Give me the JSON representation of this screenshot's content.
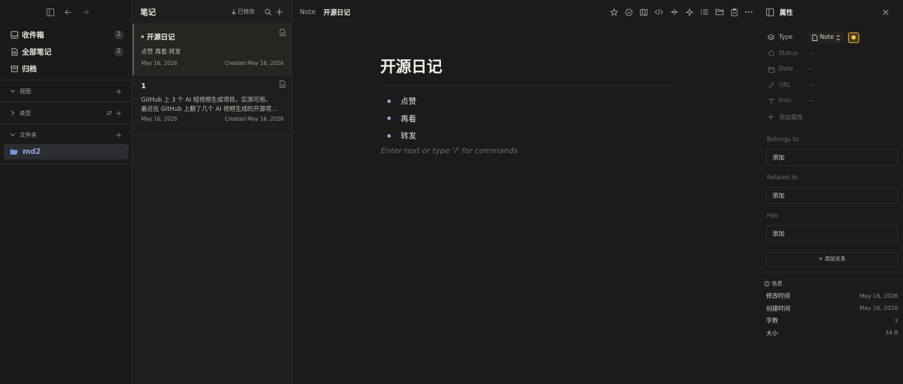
{
  "sidebar": {
    "items": [
      {
        "label": "收件箱",
        "count": "2",
        "icon": "inbox-icon"
      },
      {
        "label": "全部笔记",
        "count": "2",
        "icon": "all-notes-icon"
      },
      {
        "label": "归档",
        "count": "",
        "icon": "archive-icon"
      }
    ],
    "sections": [
      {
        "label": "视图"
      },
      {
        "label": "类型"
      },
      {
        "label": "文件夹"
      }
    ],
    "folder": "md2"
  },
  "notelist": {
    "title": "笔记",
    "sort_label": "已修改",
    "notes": [
      {
        "title": "开源日记",
        "excerpt": "点赞 再看 转发",
        "modified": "May 16, 2026",
        "created": "Created May 16, 2026"
      },
      {
        "title": "1",
        "excerpt_line1": "GitHub 上 3 个 AI 短视频生成项目，实测可用。",
        "excerpt_line2": "最近在 GitHub 上翻了几个 AI 视频生成的开源项...",
        "modified": "May 16, 2026",
        "created": "Created May 16, 2026"
      }
    ]
  },
  "editor": {
    "breadcrumb_type": "Note",
    "breadcrumb_title": "开源日记",
    "doc_title": "开源日记",
    "bullets": [
      "点赞",
      "再看",
      "转发"
    ],
    "placeholder": "Enter text or type '/' for commands"
  },
  "props": {
    "title": "属性",
    "type_name": "Type",
    "type_value": "Note",
    "rows": [
      {
        "name": "Status",
        "value": "—"
      },
      {
        "name": "Date",
        "value": "—"
      },
      {
        "name": "URL",
        "value": "—"
      },
      {
        "name": "Icon",
        "value": "—"
      }
    ],
    "add_property": "添加属性",
    "relations": [
      {
        "label": "Belongs to",
        "button": "添加"
      },
      {
        "label": "Related to",
        "button": "添加"
      },
      {
        "label": "Has",
        "button": "添加"
      }
    ],
    "add_relation": "+ 添加关系",
    "info_title": "信息",
    "info": [
      {
        "k": "修改时间",
        "v": "May 16, 2026"
      },
      {
        "k": "创建时间",
        "v": "May 16, 2026"
      },
      {
        "k": "字数",
        "v": "3"
      },
      {
        "k": "大小",
        "v": "34 B"
      }
    ]
  },
  "colors": {
    "accent_blue": "#8fa6e8",
    "type_chip": "#f2c94c",
    "status_dot": "#8fbf95"
  }
}
